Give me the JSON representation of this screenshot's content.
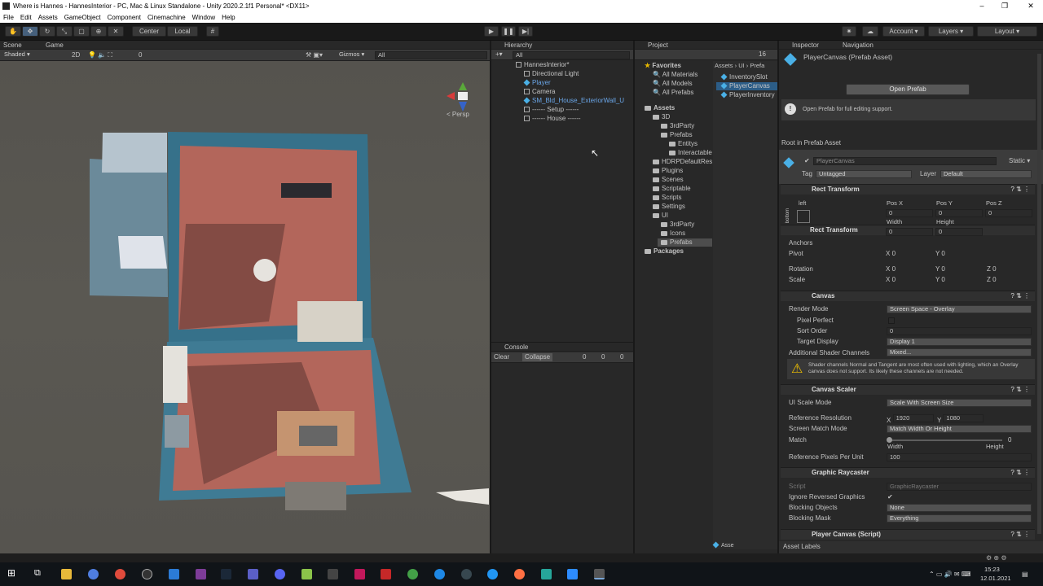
{
  "window": {
    "title": "Where is Hannes - HannesInterior - PC, Mac & Linux Standalone - Unity 2020.2.1f1 Personal* <DX11>"
  },
  "menu": [
    "File",
    "Edit",
    "Assets",
    "GameObject",
    "Component",
    "Cinemachine",
    "Window",
    "Help"
  ],
  "toolbar": {
    "center_label": "Center",
    "local_label": "Local",
    "account_label": "Account",
    "layers_label": "Layers",
    "layout_label": "Layout"
  },
  "scene": {
    "tab_scene": "Scene",
    "tab_game": "Game",
    "shading": "Shaded",
    "mode2d": "2D",
    "gizmos": "Gizmos",
    "search": "All",
    "layer_count": "0",
    "persp": "< Persp"
  },
  "hierarchy": {
    "tab": "Hierarchy",
    "search": "All",
    "items": [
      {
        "label": "HannesInterior*",
        "type": "scene"
      },
      {
        "label": "Directional Light",
        "type": "go"
      },
      {
        "label": "Player",
        "type": "prefab"
      },
      {
        "label": "Camera",
        "type": "go"
      },
      {
        "label": "SM_Bld_House_ExteriorWall_U",
        "type": "prefab"
      },
      {
        "label": "------ Setup ------",
        "type": "go"
      },
      {
        "label": "------ House ------",
        "type": "go"
      }
    ]
  },
  "console": {
    "tab": "Console",
    "clear": "Clear",
    "collapse": "Collapse",
    "counts": [
      "0",
      "0",
      "0"
    ]
  },
  "project": {
    "tab": "Project",
    "count": "16",
    "breadcrumb": [
      "Assets",
      "UI",
      "Prefa"
    ],
    "favorites_label": "Favorites",
    "favorites": [
      "All Materials",
      "All Models",
      "All Prefabs"
    ],
    "tree": [
      {
        "label": "Assets",
        "depth": 0
      },
      {
        "label": "3D",
        "depth": 1
      },
      {
        "label": "3rdParty",
        "depth": 2
      },
      {
        "label": "Prefabs",
        "depth": 2
      },
      {
        "label": "Entitys",
        "depth": 3
      },
      {
        "label": "Interactable",
        "depth": 3
      },
      {
        "label": "HDRPDefaultRes",
        "depth": 1
      },
      {
        "label": "Plugins",
        "depth": 1
      },
      {
        "label": "Scenes",
        "depth": 1
      },
      {
        "label": "Scriptable",
        "depth": 1
      },
      {
        "label": "Scripts",
        "depth": 1
      },
      {
        "label": "Settings",
        "depth": 1
      },
      {
        "label": "UI",
        "depth": 1
      },
      {
        "label": "3rdParty",
        "depth": 2
      },
      {
        "label": "Icons",
        "depth": 2
      },
      {
        "label": "Prefabs",
        "depth": 2
      },
      {
        "label": "Packages",
        "depth": 0
      }
    ],
    "files": [
      "InventorySlot",
      "PlayerCanvas",
      "PlayerInventory"
    ],
    "footer": "Asse"
  },
  "inspector": {
    "tab": "Inspector",
    "tab2": "Navigation",
    "asset_title": "PlayerCanvas (Prefab Asset)",
    "open_prefab": "Open Prefab",
    "info": "Open Prefab for full editing support.",
    "root_label": "Root in Prefab Asset",
    "go_name": "PlayerCanvas",
    "static_label": "Static",
    "tag_label": "Tag",
    "tag_value": "Untagged",
    "layer_label": "Layer",
    "layer_value": "Default",
    "rect": {
      "title": "Rect Transform",
      "left": "left",
      "bottom": "bottom",
      "posx_label": "Pos X",
      "posy_label": "Pos Y",
      "posz_label": "Pos Z",
      "posx": "0",
      "posy": "0",
      "posz": "0",
      "width_label": "Width",
      "height_label": "Height",
      "width": "0",
      "height": "0",
      "anchors": "Anchors",
      "pivot": "Pivot",
      "pivot_x": "0",
      "pivot_y": "0",
      "rotation": "Rotation",
      "rot_x": "0",
      "rot_y": "0",
      "rot_z": "0",
      "scale": "Scale",
      "scale_x": "0",
      "scale_y": "0",
      "scale_z": "0"
    },
    "canvas": {
      "title": "Canvas",
      "render_mode_label": "Render Mode",
      "render_mode": "Screen Space - Overlay",
      "pixel_perfect": "Pixel Perfect",
      "sort_order_label": "Sort Order",
      "sort_order": "0",
      "target_display_label": "Target Display",
      "target_display": "Display 1",
      "shader_channels_label": "Additional Shader Channels",
      "shader_channels": "Mixed...",
      "warning": "Shader channels Normal and Tangent are most often used with lighting, which an Overlay canvas does not support. Its likely these channels are not needed."
    },
    "scaler": {
      "title": "Canvas Scaler",
      "ui_scale_label": "UI Scale Mode",
      "ui_scale": "Scale With Screen Size",
      "ref_res_label": "Reference Resolution",
      "ref_x": "1920",
      "ref_y": "1080",
      "match_mode_label": "Screen Match Mode",
      "match_mode": "Match Width Or Height",
      "match_label": "Match",
      "match_value": "0",
      "width_label": "Width",
      "height_label": "Height",
      "ppu_label": "Reference Pixels Per Unit",
      "ppu": "100"
    },
    "raycaster": {
      "title": "Graphic Raycaster",
      "script_label": "Script",
      "script": "GraphicRaycaster",
      "ignore_label": "Ignore Reversed Graphics",
      "blocking_label": "Blocking Objects",
      "blocking": "None",
      "mask_label": "Blocking Mask",
      "mask": "Everything"
    },
    "script": {
      "title": "Player Canvas (Script)"
    },
    "asset_labels": "Asset Labels"
  },
  "taskbar": {
    "time": "15:23",
    "date": "12.01.2021"
  }
}
